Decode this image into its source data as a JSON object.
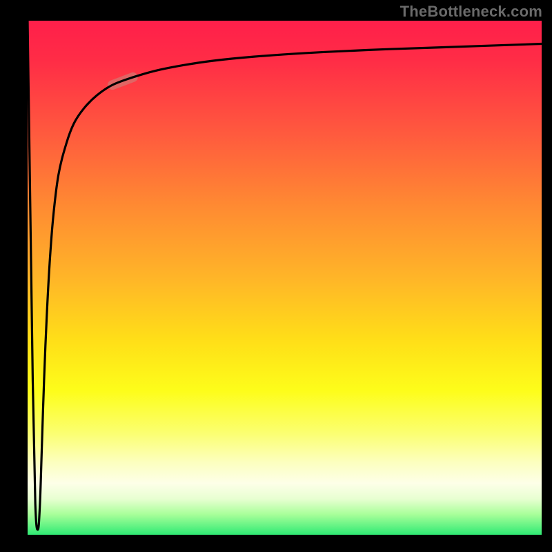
{
  "watermark": "TheBottleneck.com",
  "chart_data": {
    "type": "line",
    "title": "",
    "xlabel": "",
    "ylabel": "",
    "xlim": [
      0,
      100
    ],
    "ylim": [
      0,
      100
    ],
    "grid": false,
    "legend": false,
    "annotations": [
      {
        "name": "highlight-segment",
        "x_range": [
          16,
          21
        ],
        "note": "thicker pale overlay on curve"
      }
    ],
    "gradient_stops": [
      {
        "pct": 0,
        "color": "#ff1f4a"
      },
      {
        "pct": 22,
        "color": "#ff5a3e"
      },
      {
        "pct": 50,
        "color": "#ffb528"
      },
      {
        "pct": 72,
        "color": "#fdfd1a"
      },
      {
        "pct": 90,
        "color": "#fdffe8"
      },
      {
        "pct": 100,
        "color": "#30ea74"
      }
    ],
    "series": [
      {
        "name": "bottleneck-curve",
        "x": [
          0,
          0.5,
          1.0,
          1.5,
          2.0,
          2.4,
          2.8,
          3.2,
          3.7,
          4.3,
          5.0,
          6.0,
          7.5,
          9.0,
          11.0,
          13.5,
          16.5,
          20.5,
          25.0,
          30.0,
          36.0,
          44.0,
          54.0,
          66.0,
          80.0,
          100.0
        ],
        "y": [
          100,
          65,
          30,
          6,
          1,
          6,
          18,
          30,
          42,
          53,
          62,
          70,
          76,
          80,
          83,
          85.5,
          87.5,
          89,
          90.3,
          91.3,
          92.2,
          93.0,
          93.7,
          94.3,
          94.8,
          95.5
        ]
      }
    ]
  }
}
